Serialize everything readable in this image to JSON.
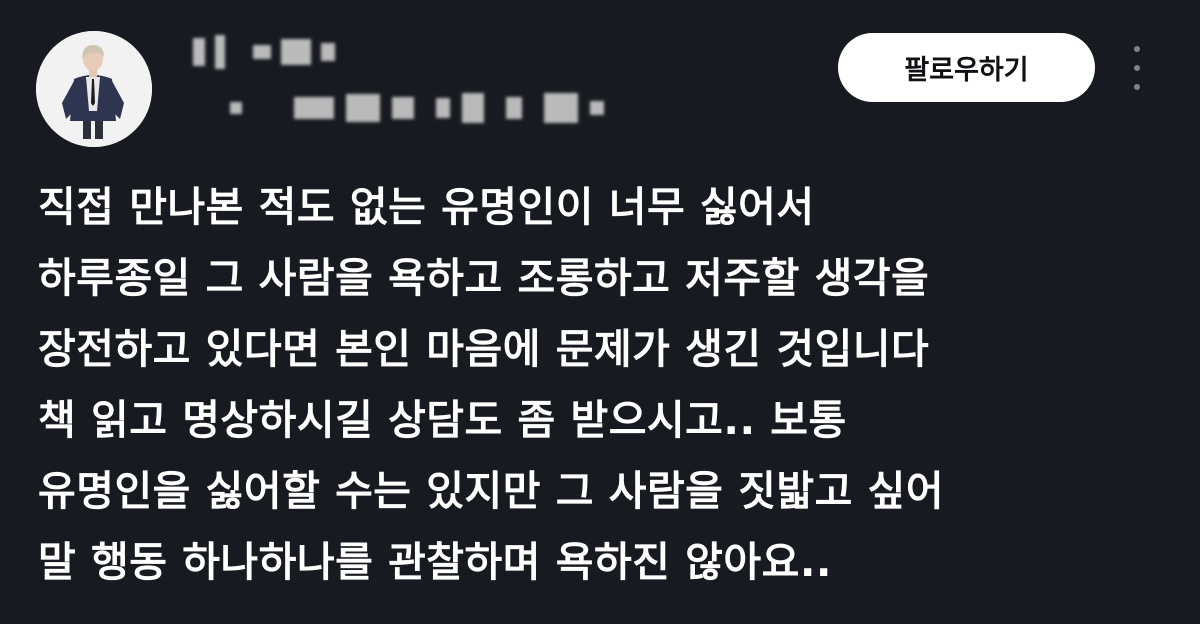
{
  "post": {
    "follow_label": "팔로우하기",
    "body_lines": [
      "직접 만나본 적도 없는 유명인이 너무 싫어서",
      "하루종일 그 사람을 욕하고 조롱하고 저주할 생각을",
      "장전하고 있다면 본인 마음에 문제가 생긴 것입니다",
      "책 읽고 명상하시길 상담도 좀 받으시고.. 보통",
      "유명인을 싫어할 수는 있지만 그 사람을 짓밟고 싶어",
      "말 행동 하나하나를 관찰하며 욕하진 않아요.."
    ]
  },
  "colors": {
    "background": "#171a20",
    "text": "#ffffff",
    "button_bg": "#ffffff",
    "button_text": "#0f1115",
    "more_dots": "#7d828a"
  },
  "icons": {
    "avatar": "profile-photo",
    "more": "vertical-ellipsis-icon"
  }
}
